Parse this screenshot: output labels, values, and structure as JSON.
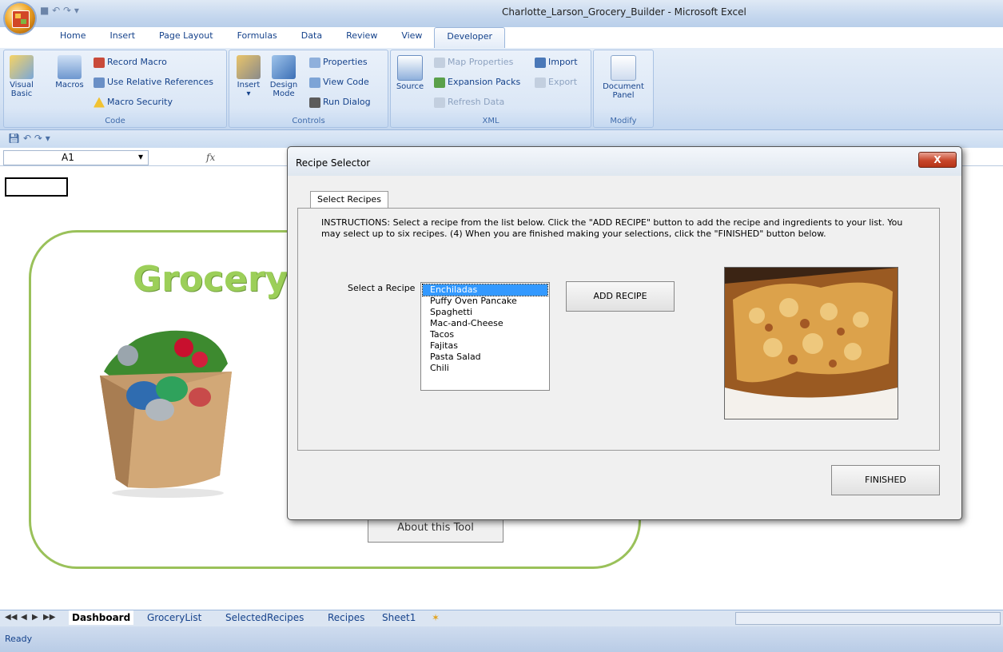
{
  "window": {
    "title": "Charlotte_Larson_Grocery_Builder - Microsoft Excel"
  },
  "ribbon": {
    "tabs": [
      "Home",
      "Insert",
      "Page Layout",
      "Formulas",
      "Data",
      "Review",
      "View",
      "Developer"
    ],
    "active_tab": "Developer",
    "groups": {
      "code": {
        "label": "Code",
        "visual_basic_line1": "Visual",
        "visual_basic_line2": "Basic",
        "macros": "Macros",
        "record_macro": "Record Macro",
        "use_relative_references": "Use Relative References",
        "macro_security": "Macro Security"
      },
      "controls": {
        "label": "Controls",
        "insert": "Insert",
        "design_mode_line1": "Design",
        "design_mode_line2": "Mode",
        "properties": "Properties",
        "view_code": "View Code",
        "run_dialog": "Run Dialog"
      },
      "xml": {
        "label": "XML",
        "source": "Source",
        "map_properties": "Map Properties",
        "expansion_packs": "Expansion Packs",
        "refresh_data": "Refresh Data",
        "import": "Import",
        "export": "Export"
      },
      "modify": {
        "label": "Modify",
        "document_panel_line1": "Document",
        "document_panel_line2": "Panel"
      }
    }
  },
  "formula_bar": {
    "name_box": "A1",
    "fx": "fx"
  },
  "sheet": {
    "heading_partial": "Grocery",
    "about_button_partial": "About this Tool"
  },
  "dialog": {
    "title": "Recipe Selector",
    "close_label": "X",
    "tab_label": "Select Recipes",
    "instructions": "INSTRUCTIONS: Select a recipe from the list below. Click the \"ADD RECIPE\" button to add the recipe and ingredients to your list. You may select up to six recipes. (4) When you are finished making your selections, click the \"FINISHED\" button below.",
    "select_label": "Select a Recipe",
    "recipes": [
      "Enchiladas",
      "Puffy Oven Pancake",
      "Spaghetti",
      "Mac-and-Cheese",
      "Tacos",
      "Fajitas",
      "Pasta Salad",
      "Chili"
    ],
    "selected_recipe": "Enchiladas",
    "add_button": "ADD RECIPE",
    "finished_button": "FINISHED"
  },
  "sheet_tabs": {
    "tabs": [
      "Dashboard",
      "GroceryList",
      "SelectedRecipes",
      "Recipes",
      "Sheet1"
    ],
    "active": "Dashboard"
  },
  "status": {
    "text": "Ready"
  },
  "colors": {
    "ribbon_text": "#15428b",
    "accent_green": "#9ac15a",
    "selection_blue": "#3399ff",
    "close_red": "#c8462a"
  }
}
